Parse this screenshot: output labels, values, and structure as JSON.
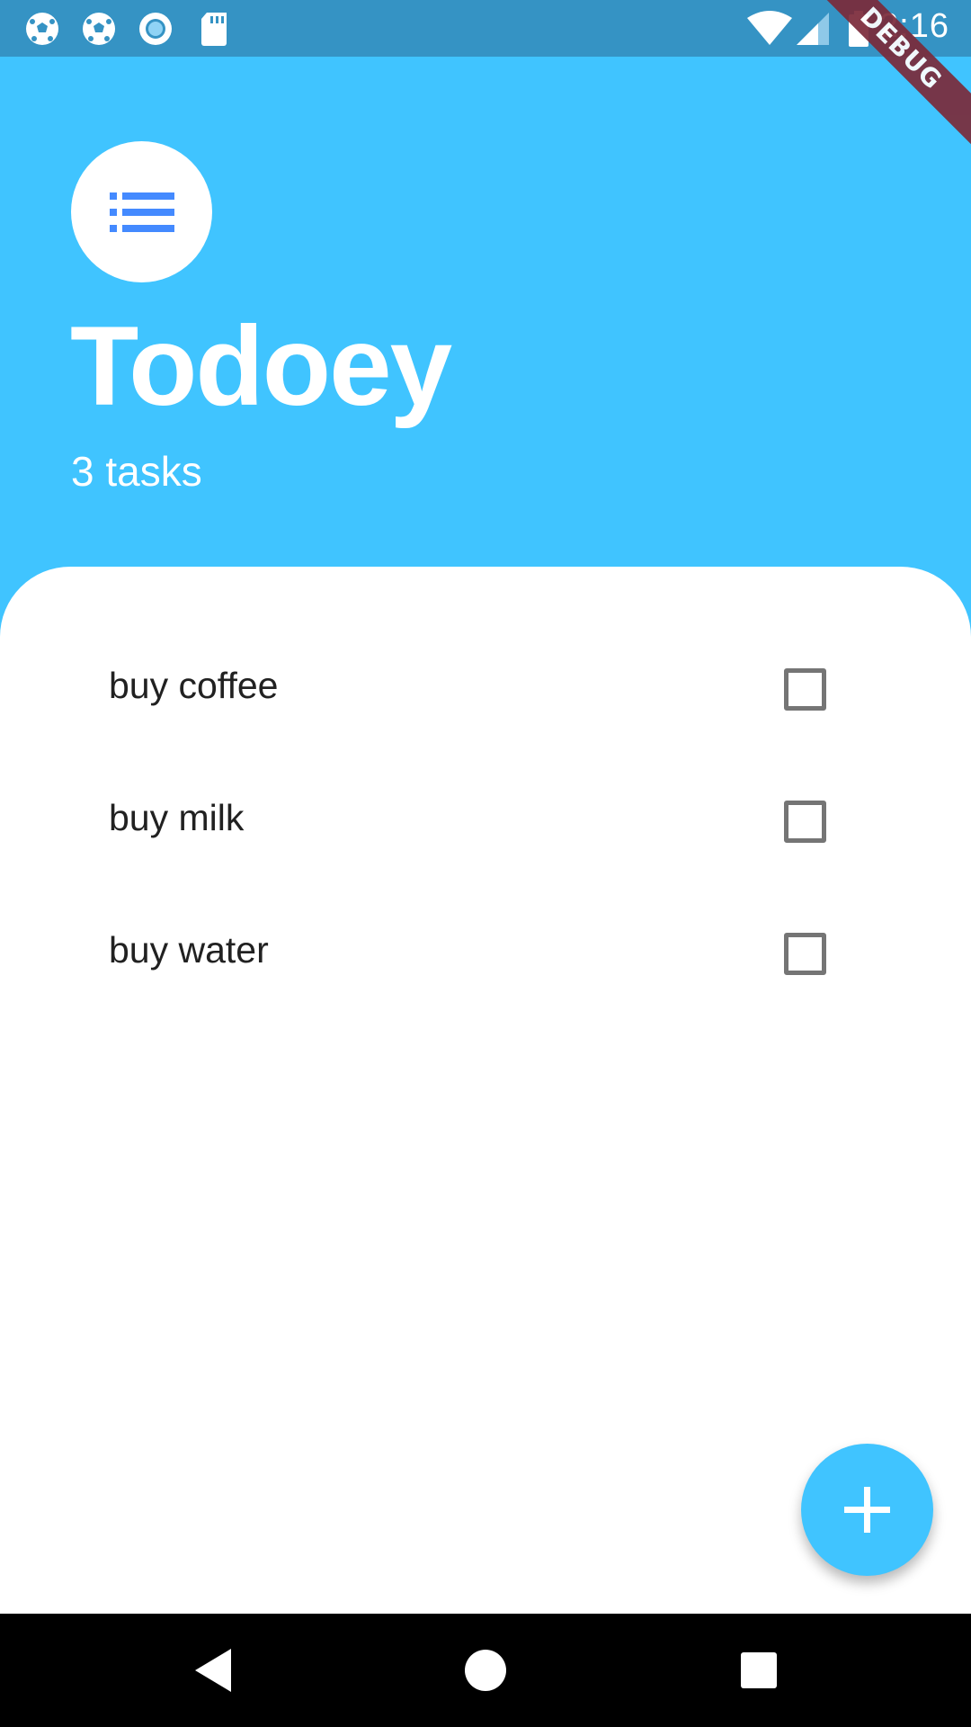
{
  "status_bar": {
    "time": "2:16",
    "left_icons": [
      "soccer-ball-icon",
      "soccer-ball-icon",
      "ring-notification-icon",
      "sd-card-icon"
    ],
    "right_icons": [
      "wifi-icon",
      "cellular-signal-icon",
      "battery-icon"
    ]
  },
  "debug_banner": "DEBUG",
  "header": {
    "logo_icon": "list-icon",
    "title": "Todoey",
    "task_count": "3 tasks"
  },
  "tasks": [
    {
      "label": "buy coffee",
      "checked": false
    },
    {
      "label": "buy milk",
      "checked": false
    },
    {
      "label": "buy water",
      "checked": false
    }
  ],
  "fab": {
    "icon": "plus-icon"
  },
  "nav_bar": {
    "icons": [
      "back-icon",
      "home-icon",
      "recents-icon"
    ]
  },
  "colors": {
    "primary": "#40c4ff",
    "status_bar": "#3593c4",
    "logo_icon": "#448aff",
    "text_dark": "#212121",
    "checkbox_border": "#757575"
  }
}
